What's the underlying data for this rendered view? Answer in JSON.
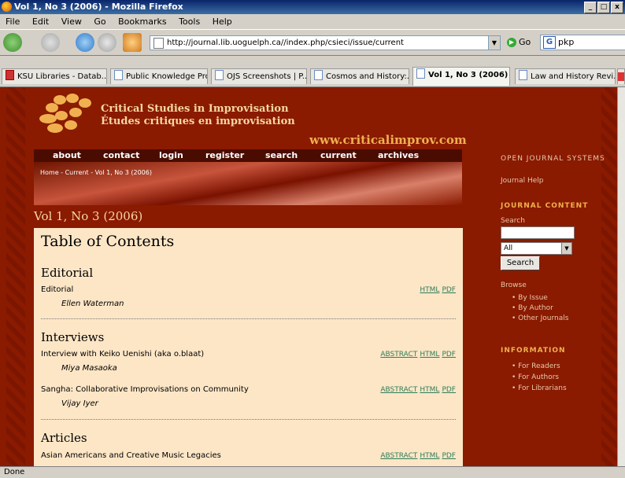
{
  "window": {
    "title": "Vol 1, No 3 (2006) - Mozilla Firefox"
  },
  "menu": [
    "File",
    "Edit",
    "View",
    "Go",
    "Bookmarks",
    "Tools",
    "Help"
  ],
  "toolbar": {
    "url": "http://journal.lib.uoguelph.ca//index.php/csieci/issue/current",
    "go_label": "Go",
    "search_value": "pkp"
  },
  "tabs": [
    {
      "label": "KSU Libraries - Datab..."
    },
    {
      "label": "Public Knowledge Pro..."
    },
    {
      "label": "OJS Screenshots | P..."
    },
    {
      "label": "Cosmos and History:..."
    },
    {
      "label": "Vol 1, No 3 (2006)"
    },
    {
      "label": "Law and History Revi..."
    }
  ],
  "site": {
    "name_line1": "Critical Studies in Improvisation",
    "name_line2": "Études critiques en improvisation",
    "url": "www.criticalimprov.com",
    "nav": [
      "about",
      "contact",
      "login",
      "register",
      "search",
      "current",
      "archives"
    ],
    "breadcrumb": "Home - Current - Vol 1, No 3 (2006)"
  },
  "issue_title": "Vol 1, No 3 (2006)",
  "toc": {
    "heading": "Table of Contents",
    "sections": [
      {
        "heading": "Editorial",
        "articles": [
          {
            "title": "Editorial",
            "author": "Ellen Waterman",
            "links": [
              "HTML",
              "PDF"
            ]
          }
        ]
      },
      {
        "heading": "Interviews",
        "articles": [
          {
            "title": "Interview with Keiko Uenishi (aka o.blaat)",
            "author": "Miya Masaoka",
            "links": [
              "ABSTRACT",
              "HTML",
              "PDF"
            ]
          },
          {
            "title": "Sangha: Collaborative Improvisations on Community",
            "author": "Vijay Iyer",
            "links": [
              "ABSTRACT",
              "HTML",
              "PDF"
            ]
          }
        ]
      },
      {
        "heading": "Articles",
        "articles": [
          {
            "title": "Asian Americans and Creative Music Legacies",
            "author": "",
            "links": [
              "ABSTRACT",
              "HTML",
              "PDF"
            ]
          }
        ]
      }
    ]
  },
  "sidebar": {
    "ojs": "OPEN JOURNAL SYSTEMS",
    "help": "Journal Help",
    "content_heading": "JOURNAL CONTENT",
    "search_label": "Search",
    "select_value": "All",
    "search_button": "Search",
    "browse_label": "Browse",
    "browse_items": [
      "By Issue",
      "By Author",
      "Other Journals"
    ],
    "info_heading": "INFORMATION",
    "info_items": [
      "For Readers",
      "For Authors",
      "For Librarians"
    ]
  },
  "status": {
    "text": "Done"
  }
}
